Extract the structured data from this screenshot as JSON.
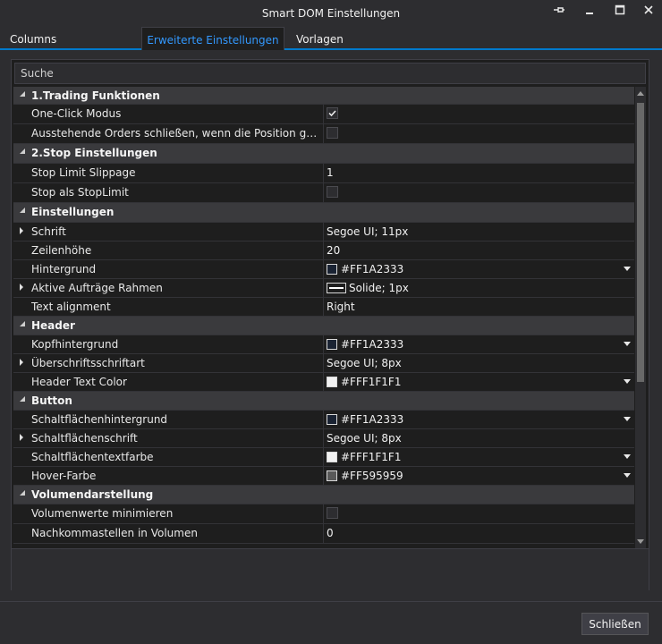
{
  "window": {
    "title": "Smart DOM Einstellungen"
  },
  "tabs": [
    {
      "label": "Columns",
      "active": false
    },
    {
      "label": "Erweiterte Einstellungen",
      "active": true
    },
    {
      "label": "Vorlagen",
      "active": false
    }
  ],
  "search": {
    "placeholder": "Suche"
  },
  "colors": {
    "accent": "#007ACC",
    "active_tab_text": "#3399FF"
  },
  "rows": [
    {
      "kind": "category",
      "label": "1.Trading Funktionen"
    },
    {
      "kind": "property",
      "name": "One-Click Modus",
      "type": "checkbox",
      "checked": true
    },
    {
      "kind": "property",
      "name": "Ausstehende Orders schließen, wenn die Position geschlossen wird",
      "type": "checkbox",
      "checked": false
    },
    {
      "kind": "category",
      "label": "2.Stop Einstellungen"
    },
    {
      "kind": "property",
      "name": "Stop Limit Slippage",
      "type": "text",
      "value": "1"
    },
    {
      "kind": "property",
      "name": "Stop als StopLimit",
      "type": "checkbox",
      "checked": false
    },
    {
      "kind": "category",
      "label": "Einstellungen"
    },
    {
      "kind": "property",
      "name": "Schrift",
      "type": "text",
      "value": "Segoe UI; 11px",
      "expandable": true
    },
    {
      "kind": "property",
      "name": "Zeilenhöhe",
      "type": "text",
      "value": "20"
    },
    {
      "kind": "property",
      "name": "Hintergrund",
      "type": "color",
      "value": "#FF1A2333",
      "swatch": "#1A2333",
      "dropdown": true
    },
    {
      "kind": "property",
      "name": "Aktive Aufträge Rahmen",
      "type": "line",
      "value": "Solide; 1px",
      "expandable": true
    },
    {
      "kind": "property",
      "name": "Text alignment",
      "type": "text",
      "value": "Right"
    },
    {
      "kind": "category",
      "label": "Header"
    },
    {
      "kind": "property",
      "name": "Kopfhintergrund",
      "type": "color",
      "value": "#FF1A2333",
      "swatch": "#1A2333",
      "dropdown": true
    },
    {
      "kind": "property",
      "name": "Überschriftsschriftart",
      "type": "text",
      "value": "Segoe UI; 8px",
      "expandable": true
    },
    {
      "kind": "property",
      "name": "Header Text Color",
      "type": "color",
      "value": "#FFF1F1F1",
      "swatch": "#F1F1F1",
      "dropdown": true
    },
    {
      "kind": "category",
      "label": "Button"
    },
    {
      "kind": "property",
      "name": "Schaltflächenhintergrund",
      "type": "color",
      "value": "#FF1A2333",
      "swatch": "#1A2333",
      "dropdown": true
    },
    {
      "kind": "property",
      "name": "Schaltflächenschrift",
      "type": "text",
      "value": "Segoe UI; 8px",
      "expandable": true
    },
    {
      "kind": "property",
      "name": "Schaltflächentextfarbe",
      "type": "color",
      "value": "#FFF1F1F1",
      "swatch": "#F1F1F1",
      "dropdown": true
    },
    {
      "kind": "property",
      "name": "Hover-Farbe",
      "type": "color",
      "value": "#FF595959",
      "swatch": "#595959",
      "dropdown": true
    },
    {
      "kind": "category",
      "label": "Volumendarstellung"
    },
    {
      "kind": "property",
      "name": "Volumenwerte minimieren",
      "type": "checkbox",
      "checked": false
    },
    {
      "kind": "property",
      "name": "Nachkommastellen in Volumen",
      "type": "text",
      "value": "0"
    }
  ],
  "footer": {
    "close_label": "Schließen"
  }
}
